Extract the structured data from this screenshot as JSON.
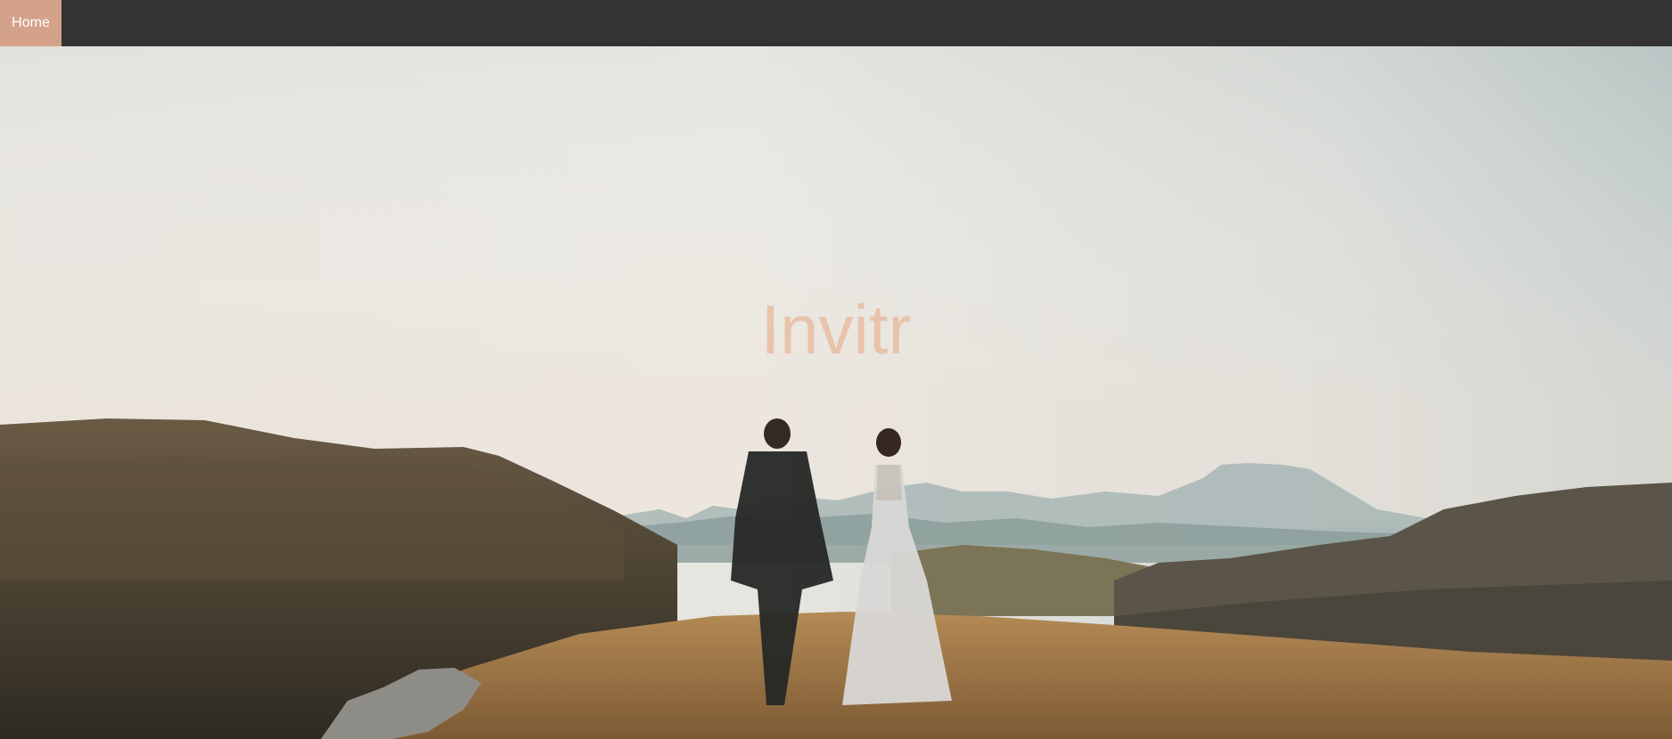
{
  "nav": {
    "items": [
      {
        "label": "Home",
        "active": true
      }
    ]
  },
  "hero": {
    "title": "Invitr"
  },
  "colors": {
    "nav_background": "#333333",
    "nav_active": "#d4a28b",
    "nav_text": "#ffffff",
    "title": "#e8c1a8"
  },
  "icons": [
    "couple-photo"
  ]
}
